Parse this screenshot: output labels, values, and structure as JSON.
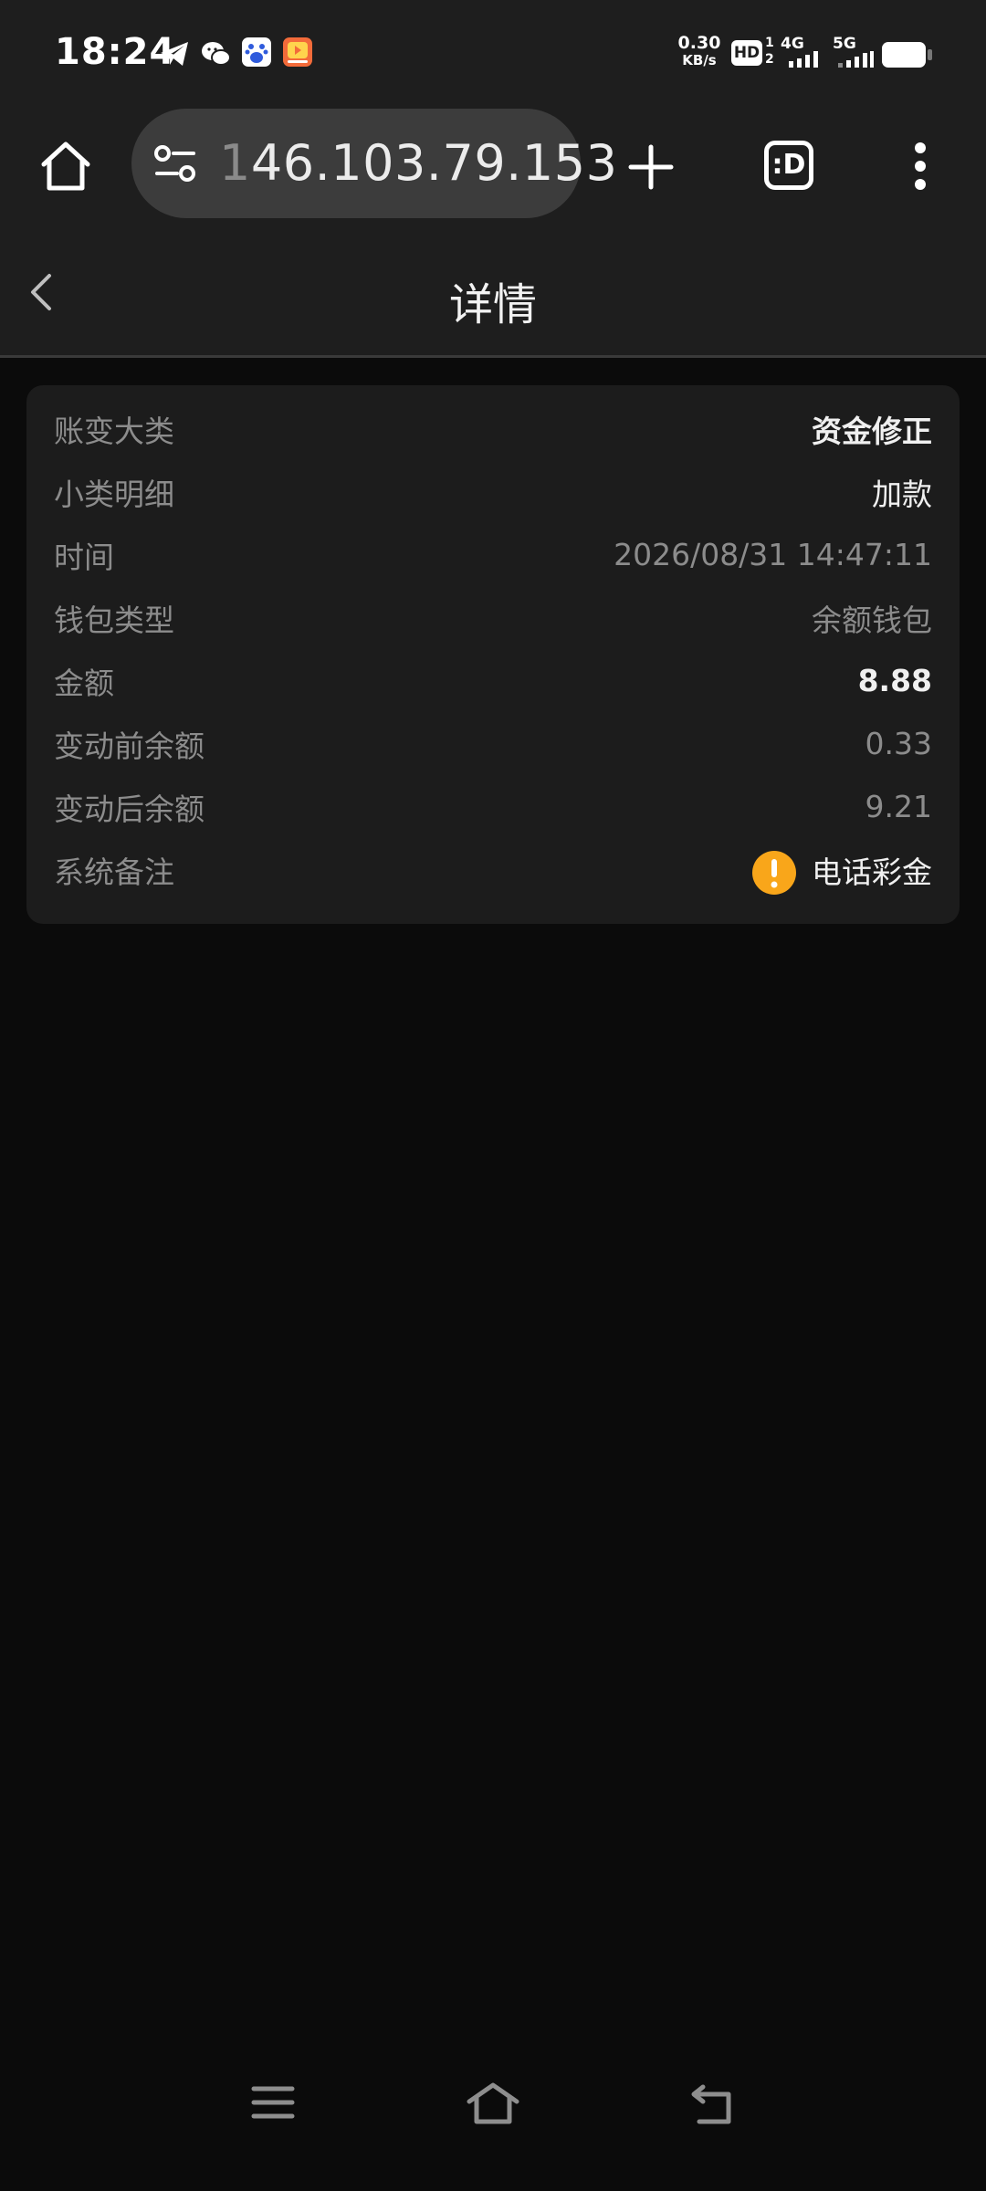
{
  "status_bar": {
    "time": "18:24",
    "net_speed_value": "0.30",
    "net_speed_unit": "KB/s",
    "hd_badge": "HD",
    "sim1_label": "4G",
    "sim2_label": "5G",
    "icons": [
      "telegram-icon",
      "wechat-icon",
      "baidu-icon",
      "video-app-icon",
      "signal-icon",
      "battery-icon"
    ]
  },
  "browser": {
    "url_dim_prefix": "1",
    "url_text": "46.103.79.153",
    "tab_button_label": ":D",
    "icons": [
      "home-icon",
      "site-settings-icon",
      "new-tab-icon",
      "tab-switcher-icon",
      "more-menu-icon"
    ]
  },
  "header": {
    "title": "详情"
  },
  "details": {
    "rows": [
      {
        "label": "账变大类",
        "value": "资金修正"
      },
      {
        "label": "小类明细",
        "value": "加款"
      },
      {
        "label": "时间",
        "value": "2026/08/31 14:47:11"
      },
      {
        "label": "钱包类型",
        "value": "余额钱包"
      },
      {
        "label": "金额",
        "value": "8.88"
      },
      {
        "label": "变动前余额",
        "value": "0.33"
      },
      {
        "label": "变动后余额",
        "value": "9.21"
      },
      {
        "label": "系统备注",
        "value": "电话彩金"
      }
    ]
  },
  "colors": {
    "warning": "#f9a61a",
    "background": "#0b0b0b",
    "card": "#1c1c1c"
  }
}
